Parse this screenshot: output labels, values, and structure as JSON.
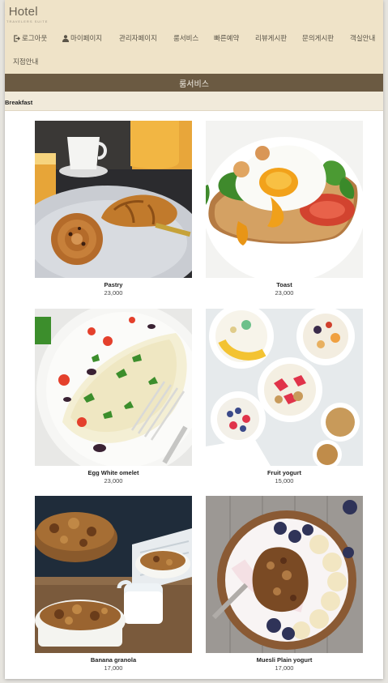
{
  "header": {
    "logo": "t Hotel",
    "logo_sub": "TRAVELERS SUITE"
  },
  "nav": {
    "items": [
      {
        "label": "로그아웃",
        "icon": "logout-icon"
      },
      {
        "label": "마이페이지",
        "icon": "user-icon"
      },
      {
        "label": "관리자페이지"
      },
      {
        "label": "룸서비스"
      },
      {
        "label": "빠른예약"
      },
      {
        "label": "리뷰게시판"
      },
      {
        "label": "문의게시판"
      },
      {
        "label": "객실안내"
      },
      {
        "label": "지점안내"
      }
    ]
  },
  "banner": {
    "title": "룸서비스"
  },
  "category": {
    "label": "Breakfast"
  },
  "menu": {
    "items": [
      {
        "name": "Pastry",
        "price": "23,000"
      },
      {
        "name": "Toast",
        "price": "23,000"
      },
      {
        "name": "Egg White omelet",
        "price": "23,000"
      },
      {
        "name": "Fruit yogurt",
        "price": "15,000"
      },
      {
        "name": "Banana granola",
        "price": "17,000"
      },
      {
        "name": "Muesli Plain yogurt",
        "price": "17,000"
      }
    ]
  },
  "colors": {
    "header_bg": "#efe3c8",
    "banner_bg": "#6b5a42",
    "subbar_bg": "#f1eada"
  }
}
